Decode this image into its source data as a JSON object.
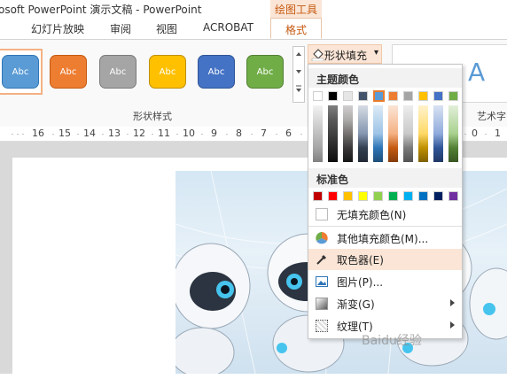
{
  "window": {
    "title": "osoft PowerPoint 演示文稿 - PowerPoint"
  },
  "context_tab": {
    "label": "绘图工具"
  },
  "tabs": [
    "幻灯片放映",
    "审阅",
    "视图",
    "ACROBAT",
    "格式"
  ],
  "ribbon": {
    "shape_styles_label": "形状样式",
    "wordart_label": "艺术字",
    "wordart_glyph": "A",
    "style_swatches": [
      {
        "text": "Abc",
        "color": "#5b9bd5"
      },
      {
        "text": "Abc",
        "color": "#ed7d31"
      },
      {
        "text": "Abc",
        "color": "#a5a5a5"
      },
      {
        "text": "Abc",
        "color": "#ffc000"
      },
      {
        "text": "Abc",
        "color": "#4472c4"
      },
      {
        "text": "Abc",
        "color": "#70ad47"
      }
    ],
    "shape_fill_button": "形状填充",
    "ruler_numbers": [
      "16",
      "15",
      "14",
      "13",
      "12",
      "11",
      "10",
      "9",
      "8",
      "7",
      "6",
      "0",
      "1"
    ]
  },
  "dropdown": {
    "theme_colors_header": "主题颜色",
    "theme_colors": [
      "#ffffff",
      "#000000",
      "#e7e6e6",
      "#44546a",
      "#5b9bd5",
      "#ed7d31",
      "#a5a5a5",
      "#ffc000",
      "#4472c4",
      "#70ad47"
    ],
    "standard_colors_header": "标准色",
    "standard_colors": [
      "#c00000",
      "#ff0000",
      "#ffc000",
      "#ffff00",
      "#92d050",
      "#00b050",
      "#00b0f0",
      "#0070c0",
      "#002060",
      "#7030a0"
    ],
    "items": {
      "no_fill": "无填充颜色(N)",
      "more_colors": "其他填充颜色(M)...",
      "eyedropper": "取色器(E)",
      "picture": "图片(P)...",
      "gradient": "渐变(G)",
      "texture": "纹理(T)"
    }
  },
  "watermark": "Baidu经验"
}
